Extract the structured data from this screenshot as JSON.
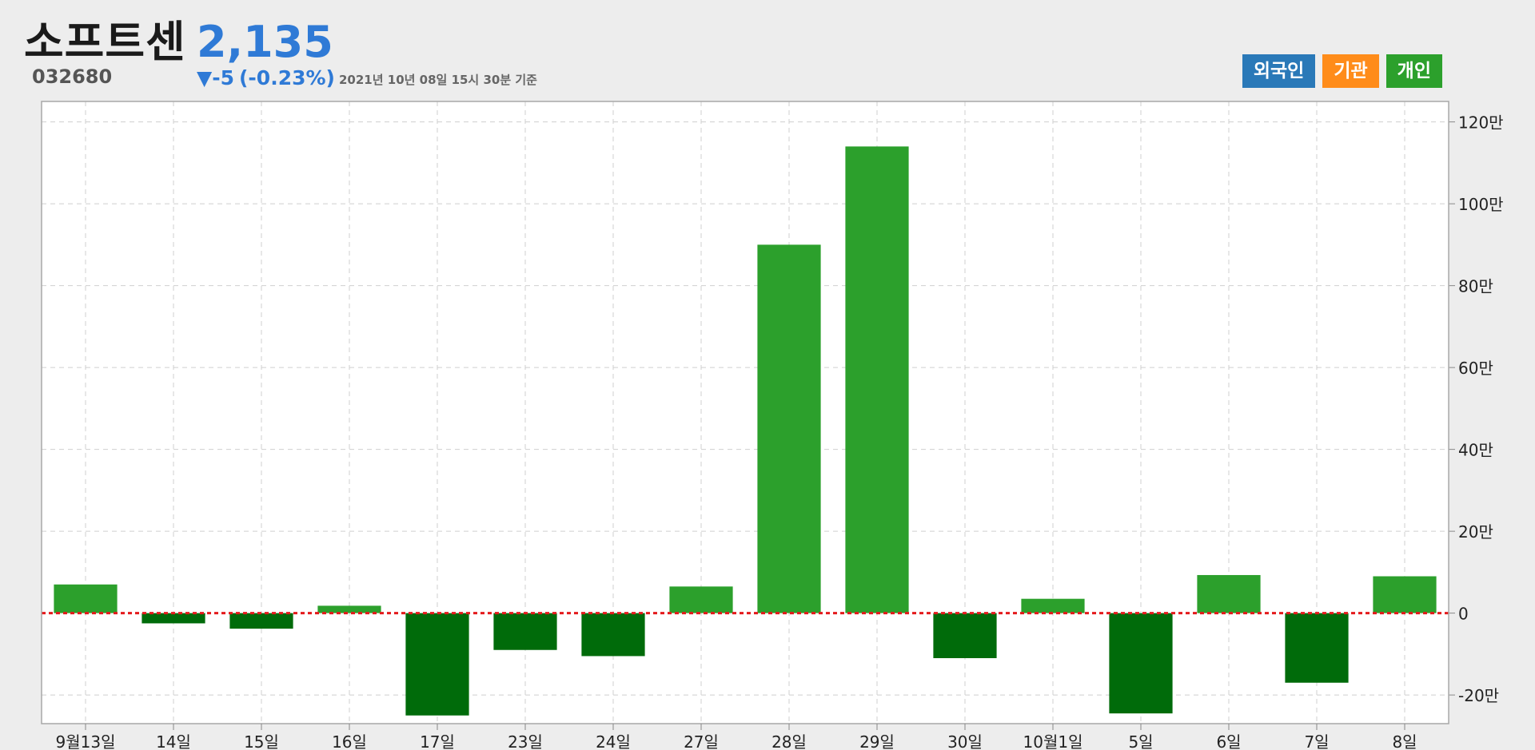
{
  "header": {
    "stock_name": "소프트센",
    "stock_code": "032680",
    "price": "2,135",
    "change": "▼-5",
    "change_pct": "(-0.23%)",
    "timestamp": "2021년 10년 08일 15시 30분 기준"
  },
  "legend": [
    {
      "label": "외국인",
      "color": "#2a79b8"
    },
    {
      "label": "기관",
      "color": "#ff8c1a"
    },
    {
      "label": "개인",
      "color": "#2ca02c"
    }
  ],
  "colors": {
    "positive": "#2ca02c",
    "negative": "#006b0a",
    "zero_line": "#e41a1c",
    "grid": "#cfcfcf"
  },
  "chart_data": {
    "type": "bar",
    "categories": [
      "9월13일",
      "14일",
      "15일",
      "16일",
      "17일",
      "23일",
      "24일",
      "27일",
      "28일",
      "29일",
      "30일",
      "10월1일",
      "5일",
      "6일",
      "7일",
      "8일"
    ],
    "series": [
      {
        "values": [
          70000,
          -25000,
          -38000,
          18000,
          -250000,
          -90000,
          -105000,
          65000,
          900000,
          1140000,
          -110000,
          35000,
          -245000,
          93000,
          -170000,
          90000
        ]
      }
    ],
    "ylim": [
      -270000,
      1250000
    ],
    "yticks": [
      -200000,
      0,
      200000,
      400000,
      600000,
      800000,
      1000000,
      1200000
    ],
    "ytick_labels": [
      "-20만",
      "0",
      "20만",
      "40만",
      "60만",
      "80만",
      "100만",
      "120만"
    ],
    "grid": true,
    "y_axis_position": "right"
  }
}
